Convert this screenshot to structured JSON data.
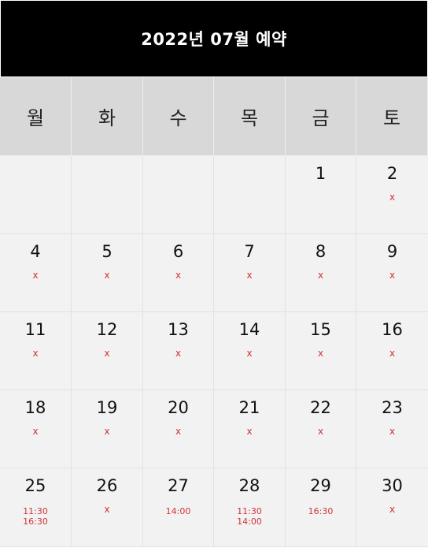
{
  "calendar": {
    "title": "2022년 07월 예약",
    "weekdays": [
      "월",
      "화",
      "수",
      "목",
      "금",
      "토"
    ],
    "weeks": [
      [
        {
          "day": "",
          "status": "",
          "times": []
        },
        {
          "day": "",
          "status": "",
          "times": []
        },
        {
          "day": "",
          "status": "",
          "times": []
        },
        {
          "day": "",
          "status": "",
          "times": []
        },
        {
          "day": "1",
          "status": "",
          "times": []
        },
        {
          "day": "2",
          "status": "x",
          "times": []
        }
      ],
      [
        {
          "day": "4",
          "status": "x",
          "times": []
        },
        {
          "day": "5",
          "status": "x",
          "times": []
        },
        {
          "day": "6",
          "status": "x",
          "times": []
        },
        {
          "day": "7",
          "status": "x",
          "times": []
        },
        {
          "day": "8",
          "status": "x",
          "times": []
        },
        {
          "day": "9",
          "status": "x",
          "times": []
        }
      ],
      [
        {
          "day": "11",
          "status": "x",
          "times": []
        },
        {
          "day": "12",
          "status": "x",
          "times": []
        },
        {
          "day": "13",
          "status": "x",
          "times": []
        },
        {
          "day": "14",
          "status": "x",
          "times": []
        },
        {
          "day": "15",
          "status": "x",
          "times": []
        },
        {
          "day": "16",
          "status": "x",
          "times": []
        }
      ],
      [
        {
          "day": "18",
          "status": "x",
          "times": []
        },
        {
          "day": "19",
          "status": "x",
          "times": []
        },
        {
          "day": "20",
          "status": "x",
          "times": []
        },
        {
          "day": "21",
          "status": "x",
          "times": []
        },
        {
          "day": "22",
          "status": "x",
          "times": []
        },
        {
          "day": "23",
          "status": "x",
          "times": []
        }
      ],
      [
        {
          "day": "25",
          "status": "",
          "times": [
            "11:30",
            "16:30"
          ]
        },
        {
          "day": "26",
          "status": "x",
          "times": []
        },
        {
          "day": "27",
          "status": "",
          "times": [
            "14:00"
          ]
        },
        {
          "day": "28",
          "status": "",
          "times": [
            "11:30",
            "14:00"
          ]
        },
        {
          "day": "29",
          "status": "",
          "times": [
            "16:30"
          ]
        },
        {
          "day": "30",
          "status": "x",
          "times": []
        }
      ]
    ]
  },
  "colors": {
    "header_bg": "#000000",
    "weekday_bg": "#d8d8d8",
    "cell_bg": "#f2f2f2",
    "status_red": "#d0333a"
  }
}
